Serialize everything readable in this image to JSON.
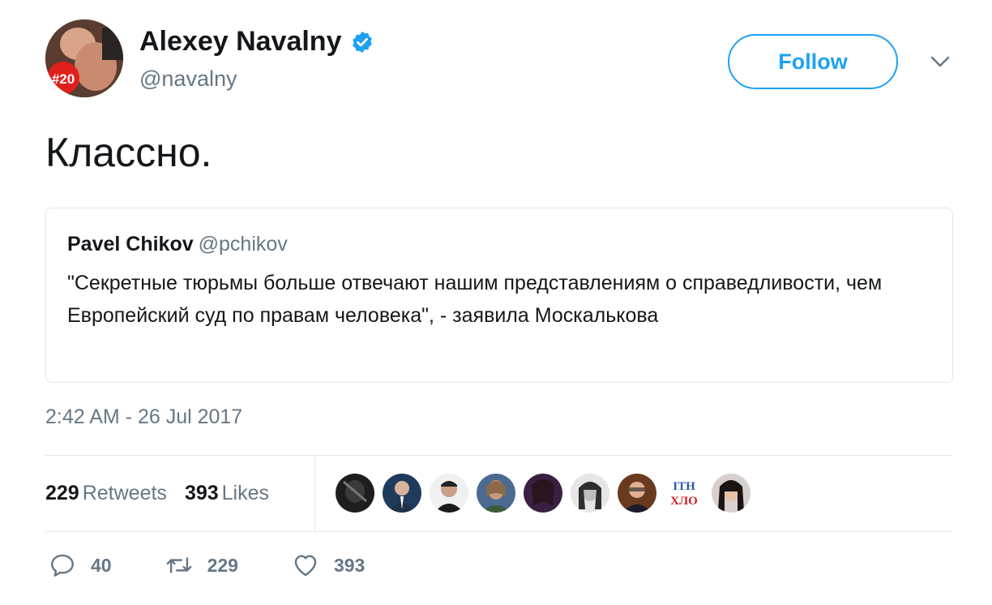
{
  "author": {
    "name": "Alexey Navalny",
    "handle": "@navalny",
    "avatar_badge": "#20",
    "verified": true
  },
  "follow_label": "Follow",
  "tweet_text": "Классно.",
  "quoted": {
    "name": "Pavel Chikov",
    "handle": "@pchikov",
    "text": "\"Секретные тюрьмы больше отвечают нашим представлениям о справедливости, чем Европейский суд по правам человека\", - заявила Москалькова"
  },
  "timestamp": "2:42 AM - 26 Jul 2017",
  "stats": {
    "retweets": "229",
    "retweets_label": "Retweets",
    "likes": "393",
    "likes_label": "Likes"
  },
  "liker_avatar_text": "ІТН ХЛО",
  "actions": {
    "replies": "40",
    "retweets": "229",
    "likes": "393"
  },
  "colors": {
    "accent": "#1da1f2",
    "secondary_text": "#657786",
    "border": "#e1e8ed"
  }
}
